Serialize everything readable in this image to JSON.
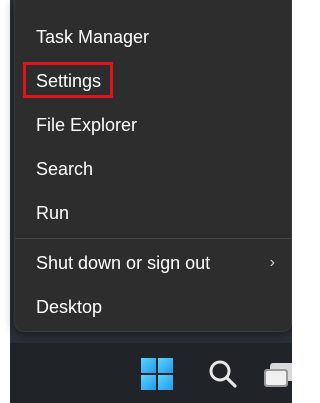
{
  "menu": {
    "items": [
      {
        "label": "Task Manager"
      },
      {
        "label": "Settings"
      },
      {
        "label": "File Explorer"
      },
      {
        "label": "Search"
      },
      {
        "label": "Run"
      },
      {
        "label": "Shut down or sign out",
        "chevron": "›"
      },
      {
        "label": "Desktop"
      }
    ],
    "highlighted_item": "Settings"
  },
  "taskbar": {
    "icons": [
      "windows-start-icon",
      "search-icon",
      "task-view-icon"
    ]
  },
  "colors": {
    "menu_background": "#2d2d2d",
    "highlight_border": "#e0141b",
    "taskbar_background": "#202428",
    "windows_blue": "#1e9ae8"
  }
}
